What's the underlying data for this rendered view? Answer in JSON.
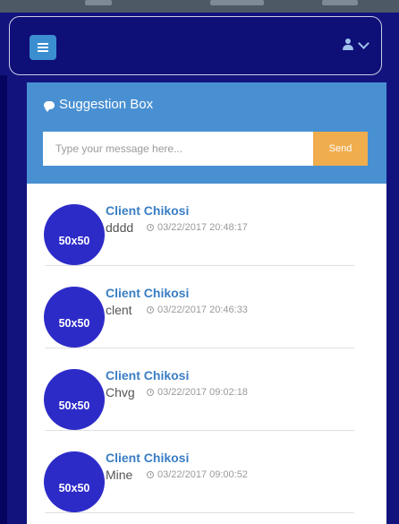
{
  "header": {
    "menu_icon": "hamburger-icon",
    "user_icon": "user-icon",
    "dropdown_icon": "chevron-down-icon"
  },
  "panel": {
    "title": "Suggestion Box",
    "title_icon": "comment-icon"
  },
  "form": {
    "placeholder": "Type your message here...",
    "send_label": "Send"
  },
  "messages": [
    {
      "avatar": "50x50",
      "name": "Client Chikosi",
      "text": "dddd",
      "time": "03/22/2017 20:48:17"
    },
    {
      "avatar": "50x50",
      "name": "Client Chikosi",
      "text": "clent",
      "time": "03/22/2017 20:46:33"
    },
    {
      "avatar": "50x50",
      "name": "Client Chikosi",
      "text": "Chvg",
      "time": "03/22/2017 09:02:18"
    },
    {
      "avatar": "50x50",
      "name": "Client Chikosi",
      "text": "Mine",
      "time": "03/22/2017 09:00:52"
    }
  ],
  "colors": {
    "page_bg": "#13137e",
    "header_bg": "#4990d2",
    "send_button": "#f0ad4e",
    "avatar": "#2d2bc8",
    "name_text": "#3a7ec4"
  }
}
